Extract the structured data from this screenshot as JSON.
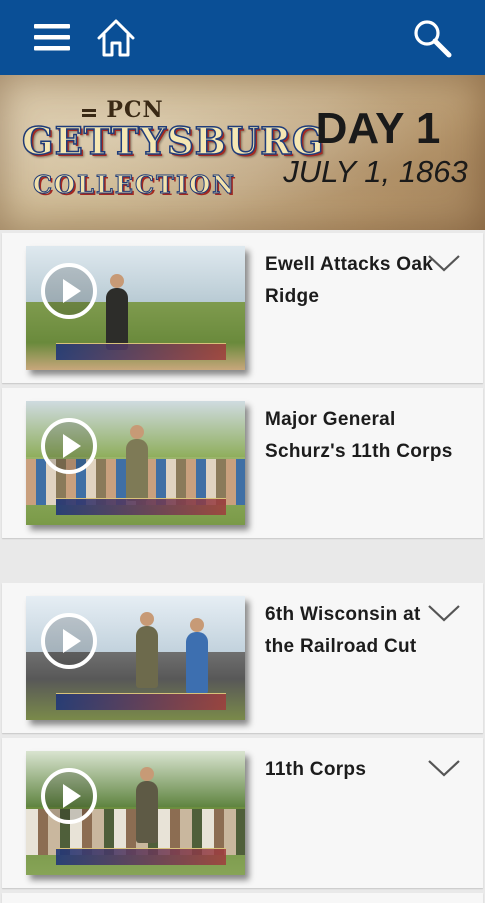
{
  "topbar": {
    "menu_icon": "hamburger-menu-icon",
    "home_icon": "home-icon",
    "search_icon": "search-icon",
    "color": "#0a4f96"
  },
  "banner": {
    "logo_top": "PCN",
    "logo_main": "GETTYSBURG",
    "logo_sub": "COLLECTION",
    "day": "DAY 1",
    "date": "JULY 1, 1863"
  },
  "videos": [
    {
      "title": "Ewell Attacks Oak Ridge",
      "has_chevron": true
    },
    {
      "title": "Major General Schurz's 11th Corps",
      "has_chevron": false
    },
    {
      "title": "6th Wisconsin at the Railroad Cut",
      "has_chevron": true
    },
    {
      "title": "11th Corps",
      "has_chevron": true
    }
  ]
}
